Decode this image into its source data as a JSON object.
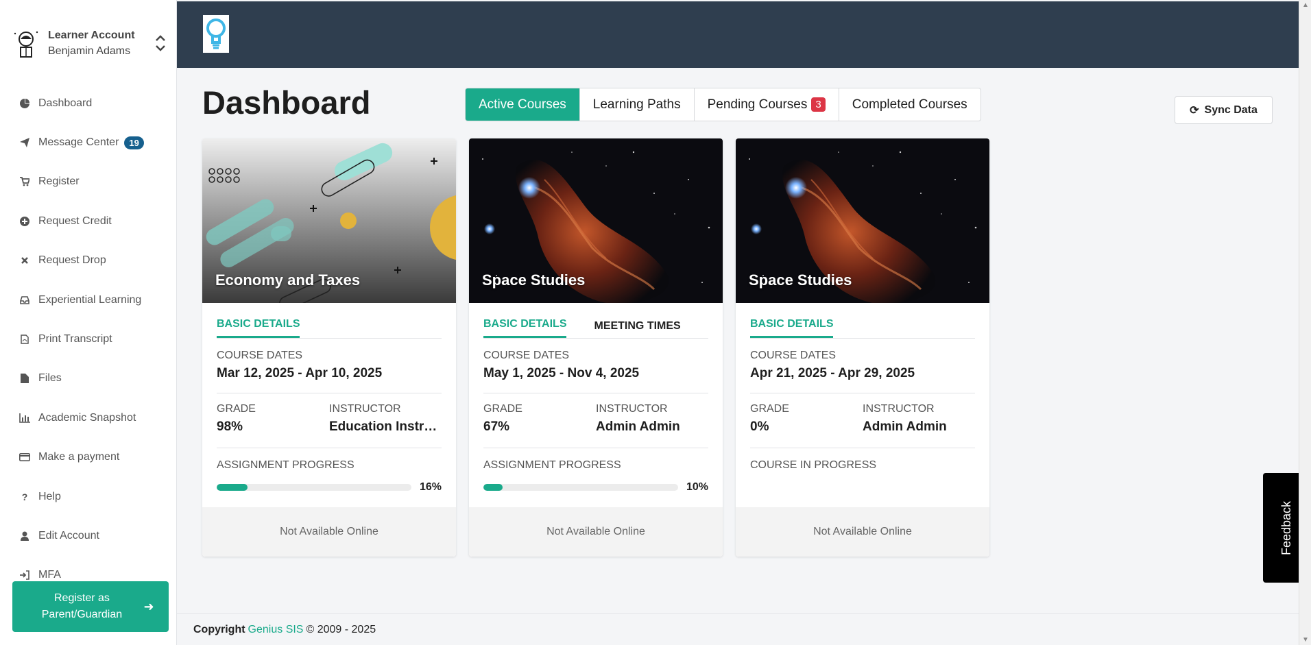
{
  "account": {
    "role": "Learner Account",
    "name": "Benjamin Adams"
  },
  "nav": [
    {
      "label": "Dashboard",
      "icon": "pie-chart-icon"
    },
    {
      "label": "Message Center",
      "icon": "paper-plane-icon",
      "badge": "19"
    },
    {
      "label": "Register",
      "icon": "cart-icon"
    },
    {
      "label": "Request Credit",
      "icon": "plus-circle-icon"
    },
    {
      "label": "Request Drop",
      "icon": "x-icon"
    },
    {
      "label": "Experiential Learning",
      "icon": "inbox-icon"
    },
    {
      "label": "Print Transcript",
      "icon": "pdf-icon"
    },
    {
      "label": "Files",
      "icon": "file-icon"
    },
    {
      "label": "Academic Snapshot",
      "icon": "bar-chart-icon"
    },
    {
      "label": "Make a payment",
      "icon": "credit-card-icon"
    },
    {
      "label": "Help",
      "icon": "question-icon"
    },
    {
      "label": "Edit Account",
      "icon": "user-icon"
    },
    {
      "label": "MFA",
      "icon": "sign-in-icon"
    }
  ],
  "parent_button": "Register as Parent/Guardian",
  "page_title": "Dashboard",
  "tabs": [
    {
      "label": "Active Courses"
    },
    {
      "label": "Learning Paths"
    },
    {
      "label": "Pending Courses",
      "badge": "3"
    },
    {
      "label": "Completed Courses"
    }
  ],
  "sync_label": "Sync Data",
  "labels": {
    "basic_details": "BASIC DETAILS",
    "meeting_times": "MEETING TIMES",
    "course_dates": "COURSE DATES",
    "grade": "GRADE",
    "instructor": "INSTRUCTOR",
    "assignment_progress": "ASSIGNMENT PROGRESS",
    "course_in_progress": "COURSE IN PROGRESS",
    "not_available": "Not Available Online"
  },
  "courses": [
    {
      "title": "Economy and Taxes",
      "dates": "Mar 12, 2025 - Apr 10, 2025",
      "grade": "98%",
      "instructor": "Education Instructor",
      "progress": "16%",
      "progress_value": 0.16
    },
    {
      "title": "Space Studies",
      "dates": "May 1, 2025 - Nov 4, 2025",
      "grade": "67%",
      "instructor": "Admin Admin",
      "progress": "10%",
      "progress_value": 0.1
    },
    {
      "title": "Space Studies",
      "dates": "Apr 21, 2025 - Apr 29, 2025",
      "grade": "0%",
      "instructor": "Admin Admin"
    }
  ],
  "footer": {
    "copyright": "Copyright",
    "brand": "Genius SIS",
    "years": "© 2009 - 2025"
  },
  "feedback_label": "Feedback",
  "colors": {
    "accent": "#1aaa8b",
    "topbar": "#2f3e4f",
    "badge_blue": "#16608e",
    "badge_red": "#dc3545"
  }
}
